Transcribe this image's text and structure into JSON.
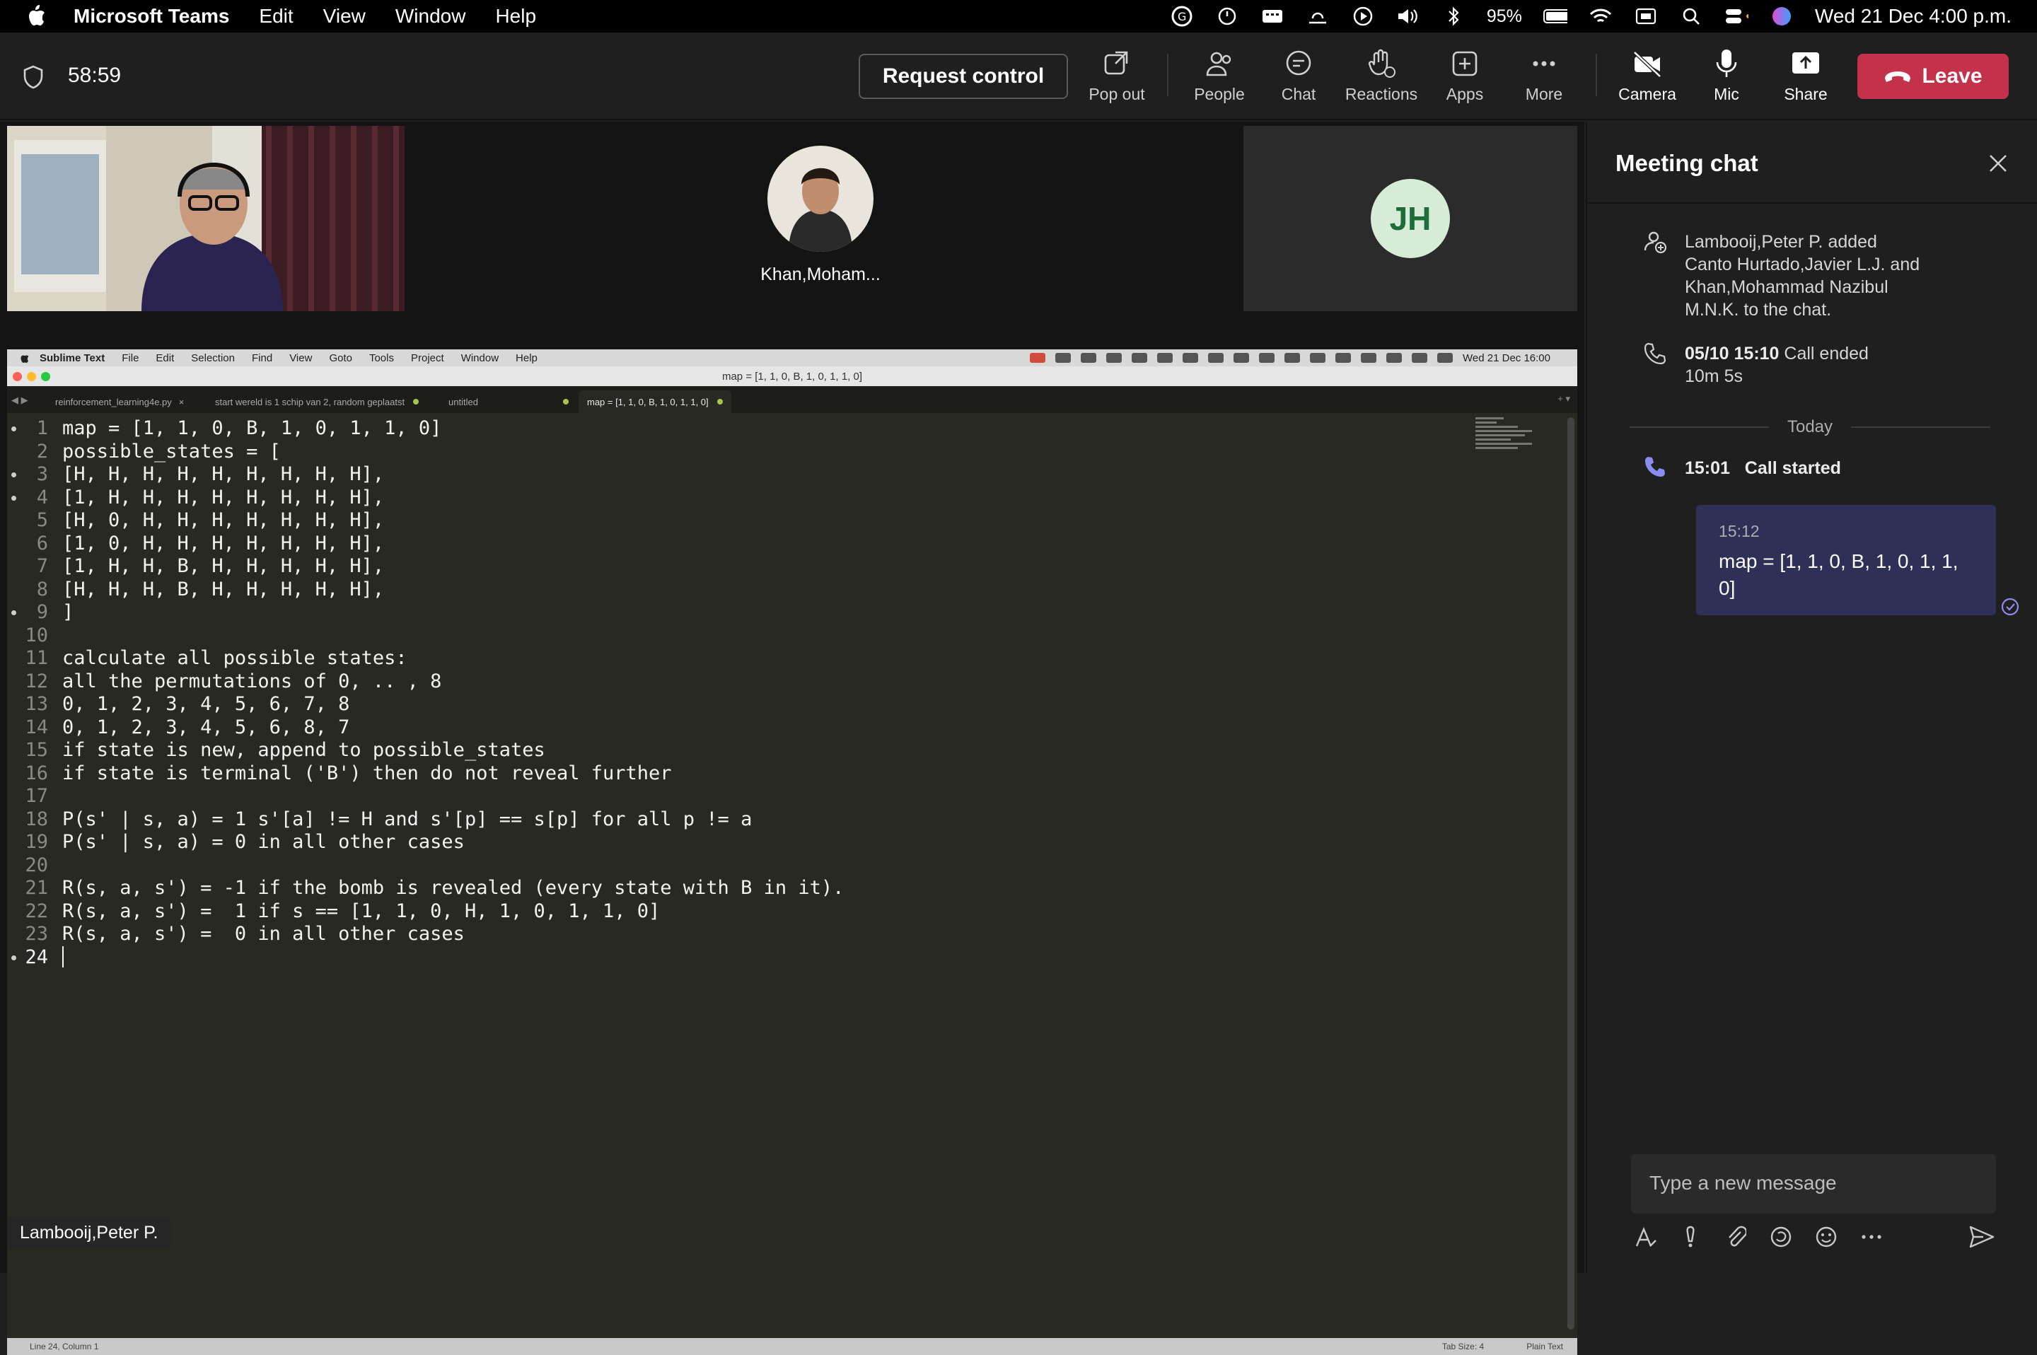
{
  "menubar": {
    "app_name": "Microsoft Teams",
    "menus": [
      "Edit",
      "View",
      "Window",
      "Help"
    ],
    "battery": "95%",
    "datetime": "Wed 21 Dec  4:00 p.m."
  },
  "toolbar": {
    "timer": "58:59",
    "request_control": "Request control",
    "pop_out": "Pop out",
    "people": "People",
    "chat": "Chat",
    "reactions": "Reactions",
    "apps": "Apps",
    "more": "More",
    "camera": "Camera",
    "mic": "Mic",
    "share": "Share",
    "leave": "Leave",
    "leave_color": "#c4314b"
  },
  "participants": {
    "p2_name": "Khan,Moham...",
    "p3_initials": "JH",
    "presenter_label": "Lambooij,Peter P."
  },
  "shared_screen": {
    "menu_app": "Sublime Text",
    "menu_items": [
      "File",
      "Edit",
      "Selection",
      "Find",
      "View",
      "Goto",
      "Tools",
      "Project",
      "Window",
      "Help"
    ],
    "menu_datetime": "Wed 21 Dec  16:00",
    "window_title": "map = [1, 1, 0, B, 1, 0, 1, 1, 0]",
    "tabs": [
      "reinforcement_learning4e.py",
      "start wereld is 1 schip van 2, random geplaatst",
      "untitled",
      "map = [1, 1, 0, B, 1, 0, 1, 1, 0]"
    ],
    "code_lines": [
      "map = [1, 1, 0, B, 1, 0, 1, 1, 0]",
      "possible_states = [",
      "[H, H, H, H, H, H, H, H, H],",
      "[1, H, H, H, H, H, H, H, H],",
      "[H, 0, H, H, H, H, H, H, H],",
      "[1, 0, H, H, H, H, H, H, H],",
      "[1, H, H, B, H, H, H, H, H],",
      "[H, H, H, B, H, H, H, H, H],",
      "]",
      "",
      "calculate all possible states:",
      "all the permutations of 0, .. , 8",
      "0, 1, 2, 3, 4, 5, 6, 7, 8",
      "0, 1, 2, 3, 4, 5, 6, 8, 7",
      "if state is new, append to possible_states",
      "if state is terminal ('B') then do not reveal further",
      "",
      "P(s' | s, a) = 1 s'[a] != H and s'[p] == s[p] for all p != a",
      "P(s' | s, a) = 0 in all other cases",
      "",
      "R(s, a, s') = -1 if the bomb is revealed (every state with B in it).",
      "R(s, a, s') =  1 if s == [1, 1, 0, H, 1, 0, 1, 1, 0]",
      "R(s, a, s') =  0 in all other cases",
      ""
    ],
    "status_left": "Line 24, Column 1",
    "status_tab": "Tab Size: 4",
    "status_syntax": "Plain Text"
  },
  "chat": {
    "title": "Meeting chat",
    "event1": "Lambooij,Peter P. added Canto Hurtado,Javier L.J. and Khan,Mohammad Nazibul M.N.K. to the chat.",
    "event2_time": "05/10 15:10",
    "event2_text": "Call ended 10m 5s",
    "divider": "Today",
    "event3_time": "15:01",
    "event3_text": "Call started",
    "message_time": "15:12",
    "message_text": "map = [1, 1, 0, B, 1, 0, 1, 1, 0]",
    "bubble_color": "#2f3058",
    "input_placeholder": "Type a new message"
  }
}
